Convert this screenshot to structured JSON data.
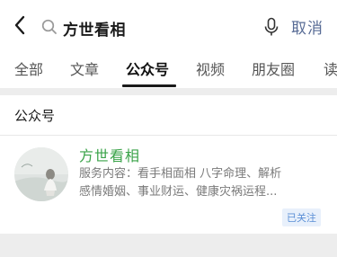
{
  "search": {
    "query": "方世看相",
    "cancel_label": "取消"
  },
  "tabs": [
    {
      "label": "全部",
      "active": false
    },
    {
      "label": "文章",
      "active": false
    },
    {
      "label": "公众号",
      "active": true
    },
    {
      "label": "视频",
      "active": false
    },
    {
      "label": "朋友圈",
      "active": false
    },
    {
      "label": "读",
      "active": false
    }
  ],
  "section": {
    "title": "公众号",
    "results": [
      {
        "name": "方世看相",
        "desc_line1": "服务内容：看手相面相 八字命理、解析",
        "desc_line2": "感情婚姻、事业财运、健康灾祸运程...",
        "badge": "已关注"
      }
    ]
  },
  "colors": {
    "accent_green": "#3aa349",
    "link_blue": "#576b95",
    "badge_blue": "#5b8fd6"
  },
  "icons": {
    "back": "chevron-left-icon",
    "search": "search-icon",
    "mic": "microphone-icon"
  }
}
